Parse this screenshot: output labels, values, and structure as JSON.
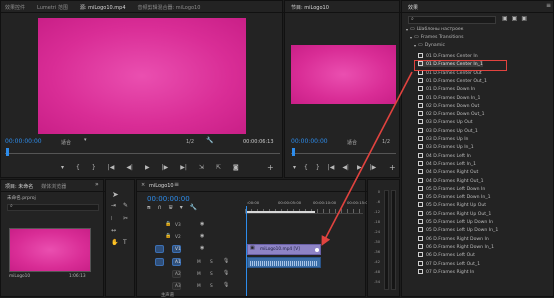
{
  "top_tabs": {
    "project_editing": "效果控件",
    "lumetri": "Lumetri 范围",
    "source": "源: miLogo10.mp4",
    "audio_mixer": "音频剪辑混合器: miLogo10"
  },
  "source_monitor": {
    "timecode_left": "00:00:00:00",
    "fit": "适合",
    "page": "1/2",
    "timecode_right": "00:00:06:13"
  },
  "program_monitor": {
    "tab": "节目: miLogo10",
    "timecode_left": "00:00:00:00",
    "fit": "适合",
    "page": "1/2"
  },
  "effects_panel": {
    "title": "效果",
    "tree": [
      {
        "label": "Шаблоны настроек",
        "level": 0,
        "open": true
      },
      {
        "label": "Frames Transitions",
        "level": 1,
        "open": true
      },
      {
        "label": "Dynamic",
        "level": 2,
        "open": true
      }
    ],
    "items": [
      "01 D.Frames Center In",
      "01 D.Frames Center In_1",
      "01 D.Frames Center Out",
      "01 D.Frames Center Out_1",
      "01 D.Frames Down In",
      "01 D.Frames Down In_1",
      "02 D.Frames Down Out",
      "02 D.Frames Down Out_1",
      "03 D.Frames Up Out",
      "03 D.Frames Up Out_1",
      "03 D.Frames Up In",
      "03 D.Frames Up In_1",
      "04 D.Frames Left In",
      "04 D.Frames Left In_1",
      "04 D.Frames Right Out",
      "04 D.Frames Right Out_1",
      "05 D.Frames Left Down In",
      "05 D.Frames Left Down In_1",
      "05 D.Frames Right Up Out",
      "05 D.Frames Right Up Out_1",
      "05 D.Frames Left Up Down In",
      "05 D.Frames Left Up Down In_1",
      "06 D.Frames Right Down In",
      "06 D.Frames Right Down In_1",
      "06 D.Frames Left Out",
      "07 D.Frames Left Out_1",
      "07 D.Frames Right In"
    ],
    "highlighted_index": 1
  },
  "project_panel": {
    "tab1": "项目: 未命名",
    "tab2": "媒体浏览器",
    "project_file": "未命名.prproj",
    "clip_name": "miLogo10",
    "clip_duration": "1:06:13"
  },
  "timeline": {
    "tab": "miLogo10",
    "timecode": "00:00:00:00",
    "ruler": [
      ":00:00",
      "00:00:05:00",
      "00:00:10:00",
      "00:00:15:00"
    ],
    "tracks": [
      "V3",
      "V2",
      "V1",
      "A1",
      "A2",
      "A3"
    ],
    "clip_label": "miLogo10.mp4 [V]",
    "master": "主声道"
  },
  "audio_meter": {
    "labels": [
      "0",
      "-6",
      "-12",
      "-18",
      "-24",
      "-30",
      "-36",
      "-42",
      "-48",
      "-54"
    ]
  },
  "colors": {
    "accent": "#2d8ceb",
    "preview_pink": "#e0349f",
    "clip_video": "#8e84c6",
    "clip_audio": "#3c6fa8",
    "highlight": "#e1433f"
  }
}
